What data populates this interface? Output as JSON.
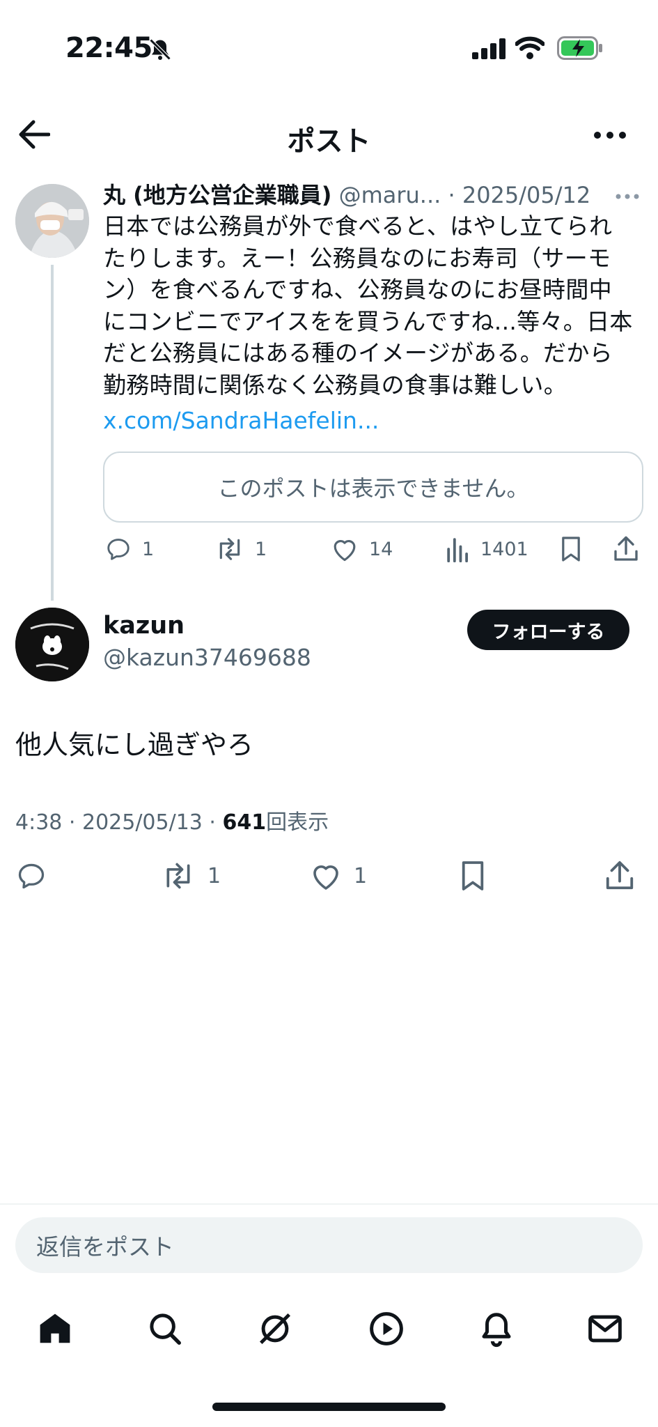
{
  "status_bar": {
    "time": "22:45"
  },
  "header": {
    "title": "ポスト"
  },
  "parent_post": {
    "display_name": "丸 (地方公営企業職員)",
    "meta": "@maru... · 2025/05/12",
    "body_lines": [
      "日本では公務員が外で食べると、はやし立てられ",
      "たりします。えー！公務員なのにお寿司（サーモ",
      "ン）を食べるんですね、公務員なのにお昼時間中",
      "にコンビニでアイスをを買うんですね...等々。日本",
      "だと公務員にはある種のイメージがある。だから",
      "勤務時間に関係なく公務員の食事は難しい。"
    ],
    "link": "x.com/SandraHaefelin...",
    "quote_unavailable": "このポストは表示できません。",
    "replies": "1",
    "reposts": "1",
    "likes": "14",
    "views": "1401"
  },
  "reply_post": {
    "display_name": "kazun",
    "handle": "@kazun37469688",
    "follow_label": "フォローする",
    "text": "他人気にし過ぎやろ",
    "time_date": "4:38 · 2025/05/13 · ",
    "views_count": "641",
    "views_label": "回表示",
    "reposts": "1",
    "likes": "1"
  },
  "compose": {
    "placeholder": "返信をポスト"
  },
  "bottom_nav": [
    "home-icon",
    "search-icon",
    "grok-icon",
    "video-icon",
    "notifications-icon",
    "messages-icon"
  ],
  "colors": {
    "accent": "#1d9bf0",
    "text": "#0f1419",
    "secondary": "#536471",
    "battery": "#34c759"
  }
}
